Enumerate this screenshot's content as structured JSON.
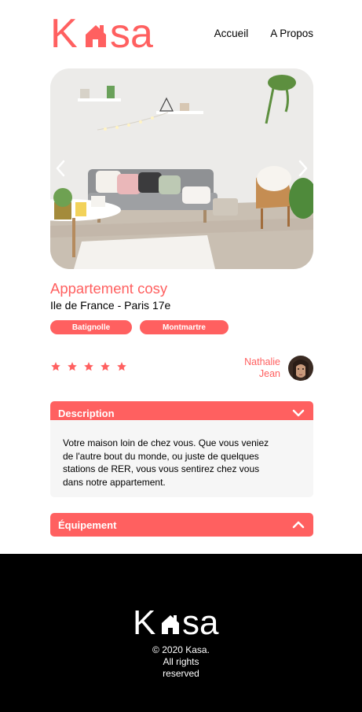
{
  "header": {
    "logo_text_k": "K",
    "logo_text_rest": "sa",
    "nav": [
      {
        "label": "Accueil"
      },
      {
        "label": "A Propos"
      }
    ]
  },
  "listing": {
    "title": "Appartement cosy",
    "location": "Ile de France - Paris 17e",
    "tags": [
      "Batignolle",
      "Montmartre"
    ],
    "rating": 5,
    "rating_max": 5,
    "host": {
      "first_name": "Nathalie",
      "last_name": "Jean"
    }
  },
  "description": {
    "label": "Description",
    "lines": [
      "Votre maison loin de chez vous. Que vous veniez",
      "de l'autre bout du monde, ou juste de quelques",
      "stations de RER, vous vous sentirez chez vous",
      "dans notre appartement."
    ]
  },
  "equipment": {
    "label": "Équipement"
  },
  "footer": {
    "logo_text_k": "K",
    "logo_text_rest": "sa",
    "copyright_lines": [
      "© 2020 Kasa.",
      "All rights",
      "reserved"
    ]
  },
  "colors": {
    "brand": "#FF6060",
    "panel": "#F6F6F6",
    "footer_bg": "#000000"
  }
}
